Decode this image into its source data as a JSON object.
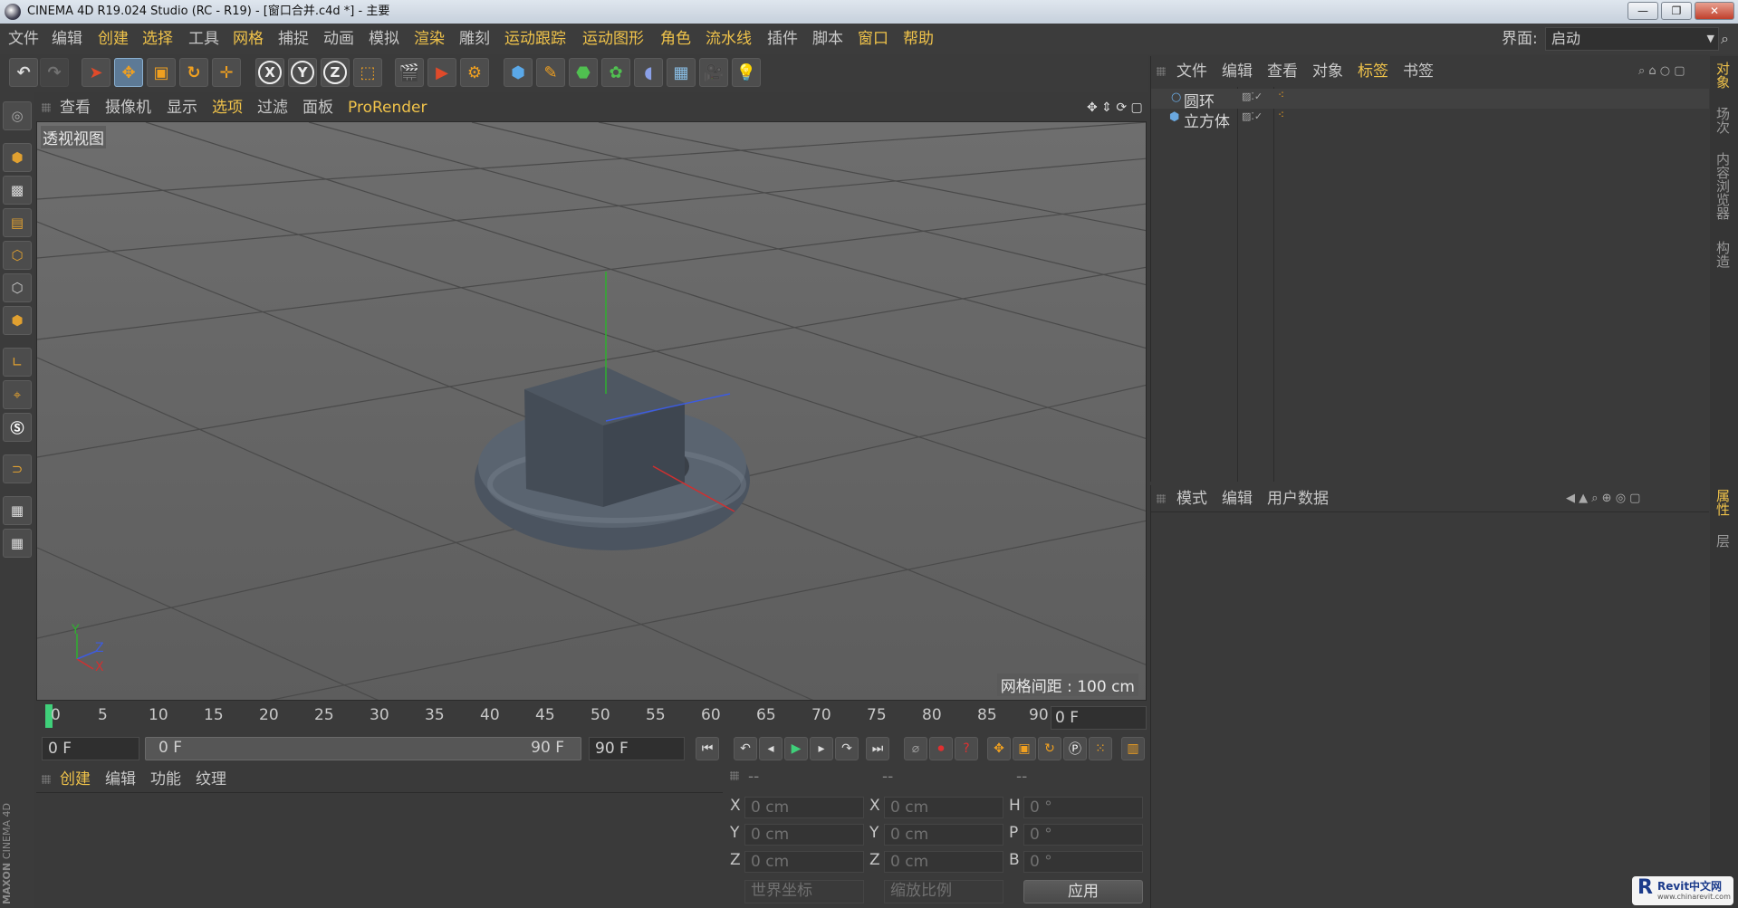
{
  "window": {
    "title": "CINEMA 4D R19.024 Studio (RC - R19) - [窗口合并.c4d *] - 主要",
    "min": "—",
    "max": "❐",
    "close": "✕"
  },
  "menu": {
    "items": [
      "文件",
      "编辑",
      "创建",
      "选择",
      "工具",
      "网格",
      "捕捉",
      "动画",
      "模拟",
      "渲染",
      "雕刻",
      "运动跟踪",
      "运动图形",
      "角色",
      "流水线",
      "插件",
      "脚本",
      "窗口",
      "帮助"
    ],
    "highlight": [
      "创建",
      "选择",
      "网格",
      "渲染",
      "运动跟踪",
      "运动图形",
      "角色",
      "流水线",
      "窗口",
      "帮助"
    ],
    "interface_label": "界面:",
    "interface_value": "启动"
  },
  "toolbar": {
    "x_label": "X",
    "y_label": "Y",
    "z_label": "Z"
  },
  "viewport": {
    "menu": [
      "查看",
      "摄像机",
      "显示",
      "选项",
      "过滤",
      "面板",
      "ProRender"
    ],
    "active_menu": "选项",
    "label": "透视视图",
    "grid_spacing": "网格间距 : 100 cm",
    "axis_y": "Y",
    "axis_z": "Z",
    "axis_x": "X"
  },
  "timeline": {
    "ticks": [
      "0",
      "5",
      "10",
      "15",
      "20",
      "25",
      "30",
      "35",
      "40",
      "45",
      "50",
      "55",
      "60",
      "65",
      "70",
      "75",
      "80",
      "85",
      "90"
    ],
    "current_frame": "0 F",
    "start": "0 F",
    "range_start": "0 F",
    "range_end": "90 F",
    "end": "90 F"
  },
  "material": {
    "menu": [
      "创建",
      "编辑",
      "功能",
      "纹理"
    ]
  },
  "coords": {
    "headers": [
      "--",
      "--",
      "--"
    ],
    "rows": [
      {
        "a": "X",
        "av": "0 cm",
        "b": "X",
        "bv": "0 cm",
        "c": "H",
        "cv": "0 °"
      },
      {
        "a": "Y",
        "av": "0 cm",
        "b": "Y",
        "bv": "0 cm",
        "c": "P",
        "cv": "0 °"
      },
      {
        "a": "Z",
        "av": "0 cm",
        "b": "Z",
        "bv": "0 cm",
        "c": "B",
        "cv": "0 °"
      }
    ],
    "world": "世界坐标",
    "scale": "缩放比例",
    "apply": "应用"
  },
  "objects": {
    "menu": [
      "文件",
      "编辑",
      "查看",
      "对象",
      "标签",
      "书签"
    ],
    "active": "标签",
    "items": [
      {
        "name": "圆环"
      },
      {
        "name": "立方体"
      }
    ]
  },
  "attributes": {
    "menu": [
      "模式",
      "编辑",
      "用户数据"
    ]
  },
  "sidetabs": [
    "对象",
    "场次",
    "内容浏览器",
    "构造",
    "属性",
    "层"
  ],
  "brand": {
    "maxon": "MAXON",
    "c4d": "CINEMA 4D",
    "watermark": "Revit中文网",
    "watermark_url": "www.chinarevit.com"
  }
}
